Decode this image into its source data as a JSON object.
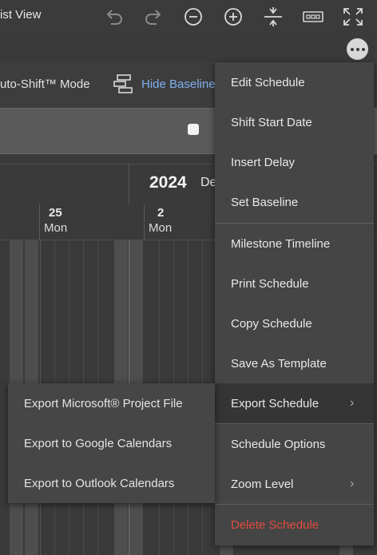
{
  "toolbar": {
    "view_title": "ist View",
    "icons": [
      "undo-icon",
      "redo-icon",
      "zoom-out-icon",
      "zoom-in-icon",
      "collapse-icon",
      "fit-width-icon",
      "fullscreen-icon"
    ]
  },
  "row2": {
    "mode_label": "uto-Shift™ Mode",
    "baseline_label": "Hide Baseline"
  },
  "timeline": {
    "year": "2024",
    "month": "De",
    "days": [
      {
        "num": "25",
        "name": "Mon"
      },
      {
        "num": "2",
        "name": "Mon"
      }
    ]
  },
  "menu": {
    "items": [
      {
        "label": "Edit Schedule"
      },
      {
        "label": "Shift Start Date"
      },
      {
        "label": "Insert Delay"
      },
      {
        "label": "Set Baseline"
      },
      {
        "label": "Milestone Timeline"
      },
      {
        "label": "Print Schedule"
      },
      {
        "label": "Copy Schedule"
      },
      {
        "label": "Save As Template"
      },
      {
        "label": "Export Schedule"
      },
      {
        "label": "Schedule Options"
      },
      {
        "label": "Zoom Level"
      },
      {
        "label": "Delete Schedule"
      }
    ],
    "danger_color": "#e04b3f"
  },
  "submenu": {
    "items": [
      {
        "label": "Export Microsoft® Project File"
      },
      {
        "label": "Export to Google Calendars"
      },
      {
        "label": "Export to Outlook Calendars"
      }
    ]
  },
  "colors": {
    "accent_link": "#7fb0f0",
    "background": "#3a3a3a"
  }
}
